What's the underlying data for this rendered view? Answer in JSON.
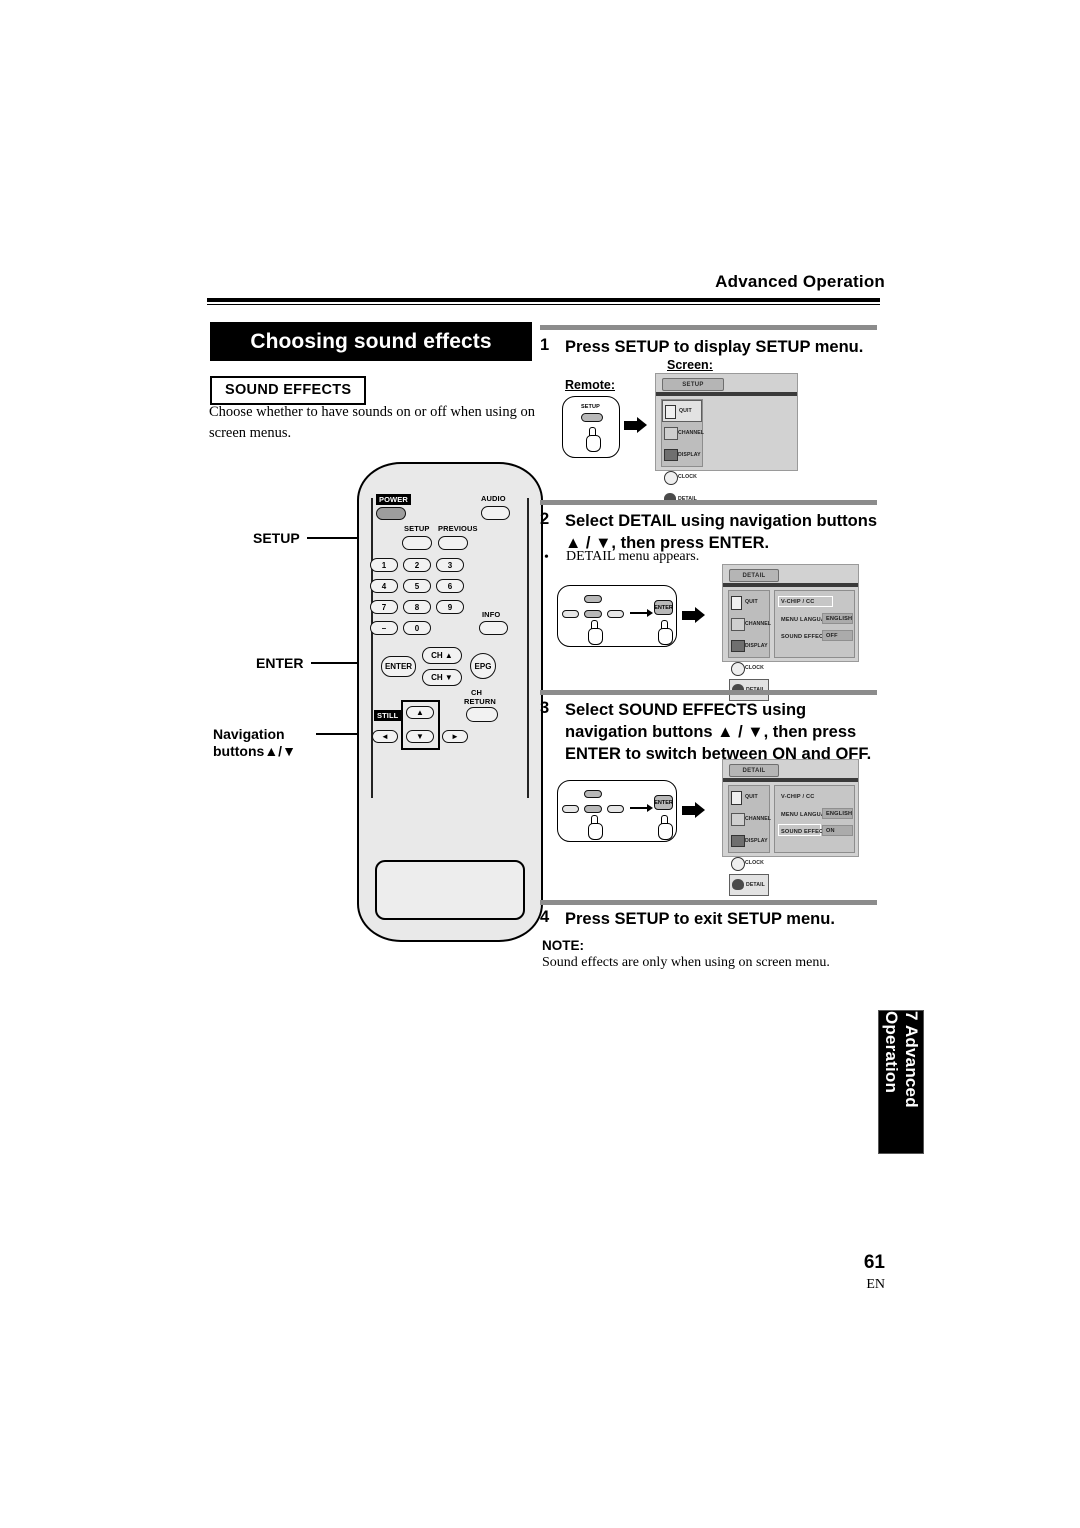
{
  "header": {
    "title": "Advanced Operation"
  },
  "section": {
    "title": "Choosing sound effects",
    "feature_label": "SOUND EFFECTS",
    "description": "Choose whether to have sounds on or off when using on screen menus."
  },
  "callouts": {
    "setup": "SETUP",
    "enter": "ENTER",
    "navigation_line1": "Navigation",
    "navigation_line2": "buttons▲/▼"
  },
  "remote": {
    "power": "POWER",
    "audio": "AUDIO",
    "setup": "SETUP",
    "previous": "PREVIOUS",
    "keys": [
      "1",
      "2",
      "3",
      "4",
      "5",
      "6",
      "7",
      "8",
      "9",
      "–",
      "0"
    ],
    "info": "INFO",
    "enter": "ENTER",
    "ch_up": "CH ▲",
    "ch_down": "CH ▼",
    "epg": "EPG",
    "ch_return_line1": "CH",
    "ch_return_line2": "RETURN",
    "still": "STILL",
    "nav_up": "▲",
    "nav_down": "▼",
    "nav_left": "◄",
    "nav_right": "►"
  },
  "labels": {
    "remote": "Remote:",
    "screen": "Screen:"
  },
  "steps": [
    {
      "num": "1",
      "text": "Press SETUP to display SETUP menu."
    },
    {
      "num": "2",
      "text": "Select DETAIL using navigation buttons ▲ / ▼, then press ENTER.",
      "bullet": "DETAIL menu appears."
    },
    {
      "num": "3",
      "text": "Select SOUND EFFECTS using navigation buttons ▲ / ▼, then press ENTER to switch between ON and OFF."
    },
    {
      "num": "4",
      "text": "Press SETUP to exit SETUP menu."
    }
  ],
  "note": {
    "head": "NOTE:",
    "body": "Sound effects are only when using on screen menu."
  },
  "osd_setup": {
    "tab": "SETUP",
    "rail": [
      {
        "name": "QUIT",
        "icon": "door-icon",
        "selected": true
      },
      {
        "name": "CHANNEL",
        "icon": "channel-icon",
        "selected": false
      },
      {
        "name": "DISPLAY",
        "icon": "display-icon",
        "selected": false
      },
      {
        "name": "CLOCK",
        "icon": "clock-icon",
        "selected": false
      },
      {
        "name": "DETAIL",
        "icon": "detail-icon",
        "selected": false
      }
    ]
  },
  "osd_detail_off": {
    "tab": "DETAIL",
    "rail": [
      {
        "name": "QUIT",
        "icon": "door-icon",
        "selected": false
      },
      {
        "name": "CHANNEL",
        "icon": "channel-icon",
        "selected": false
      },
      {
        "name": "DISPLAY",
        "icon": "display-icon",
        "selected": false
      },
      {
        "name": "CLOCK",
        "icon": "clock-icon",
        "selected": false
      },
      {
        "name": "DETAIL",
        "icon": "detail-icon",
        "selected": true
      }
    ],
    "rows": [
      {
        "label": "V-CHIP / CC",
        "value": "",
        "highlighted": true
      },
      {
        "label": "MENU LANGUAGE",
        "value": "ENGLISH",
        "highlighted": false
      },
      {
        "label": "SOUND EFFECTS",
        "value": "OFF",
        "highlighted": false
      }
    ]
  },
  "osd_detail_on": {
    "tab": "DETAIL",
    "rail": [
      {
        "name": "QUIT",
        "icon": "door-icon",
        "selected": false
      },
      {
        "name": "CHANNEL",
        "icon": "channel-icon",
        "selected": false
      },
      {
        "name": "DISPLAY",
        "icon": "display-icon",
        "selected": false
      },
      {
        "name": "CLOCK",
        "icon": "clock-icon",
        "selected": false
      },
      {
        "name": "DETAIL",
        "icon": "detail-icon",
        "selected": true
      }
    ],
    "rows": [
      {
        "label": "V-CHIP / CC",
        "value": "",
        "highlighted": false
      },
      {
        "label": "MENU LANGUAGE",
        "value": "ENGLISH",
        "highlighted": false
      },
      {
        "label": "SOUND EFFECTS",
        "value": "ON",
        "highlighted": true
      }
    ]
  },
  "press_illustration": {
    "enter_key": "ENTER"
  },
  "side_tab": {
    "text": "7 Advanced Operation"
  },
  "footer": {
    "page": "61",
    "lang": "EN"
  }
}
